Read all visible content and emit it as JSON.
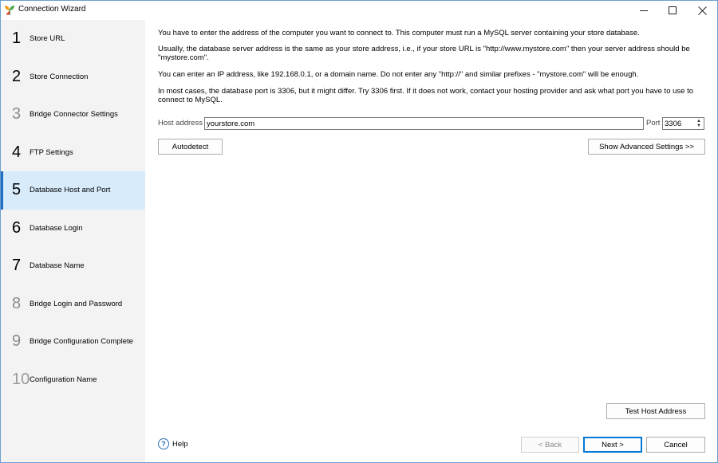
{
  "window": {
    "title": "Connection Wizard"
  },
  "sidebar": {
    "steps": [
      {
        "num": "1",
        "label": "Store URL"
      },
      {
        "num": "2",
        "label": "Store Connection"
      },
      {
        "num": "3",
        "label": "Bridge Connector Settings"
      },
      {
        "num": "4",
        "label": "FTP Settings"
      },
      {
        "num": "5",
        "label": "Database Host and Port"
      },
      {
        "num": "6",
        "label": "Database Login"
      },
      {
        "num": "7",
        "label": "Database Name"
      },
      {
        "num": "8",
        "label": "Bridge Login and Password"
      },
      {
        "num": "9",
        "label": "Bridge Configuration Complete"
      },
      {
        "num": "10",
        "label": "Configuration Name"
      }
    ],
    "active_step": "5"
  },
  "main": {
    "paragraphs": [
      "You have to enter the address of the computer you want to connect to. This computer must run a MySQL server containing your store database.",
      "Usually, the database server address is the same as your store address, i.e., if your store URL is \"http://www.mystore.com\" then your server address should be \"mystore.com\".",
      "You can enter an IP address, like 192.168.0.1, or a domain name. Do not enter any \"http://\" and similar prefixes - \"mystore.com\" will be enough.",
      "In most cases, the database port is 3306, but it might differ. Try 3306 first. If it does not work, contact your hosting provider and ask what port you have to use to connect to MySQL."
    ],
    "host_label": "Host address",
    "host_value": "yourstore.com",
    "port_label": "Port",
    "port_value": "3306",
    "autodetect_label": "Autodetect",
    "advanced_label": "Show Advanced Settings >>",
    "test_label": "Test Host Address"
  },
  "footer": {
    "help_label": "Help",
    "back_label": "< Back",
    "next_label": "Next >",
    "cancel_label": "Cancel"
  },
  "colors": {
    "accent": "#1e6ec1",
    "active_step_bg": "#d7ebfb",
    "sidebar_bg": "#f3f3f3"
  }
}
